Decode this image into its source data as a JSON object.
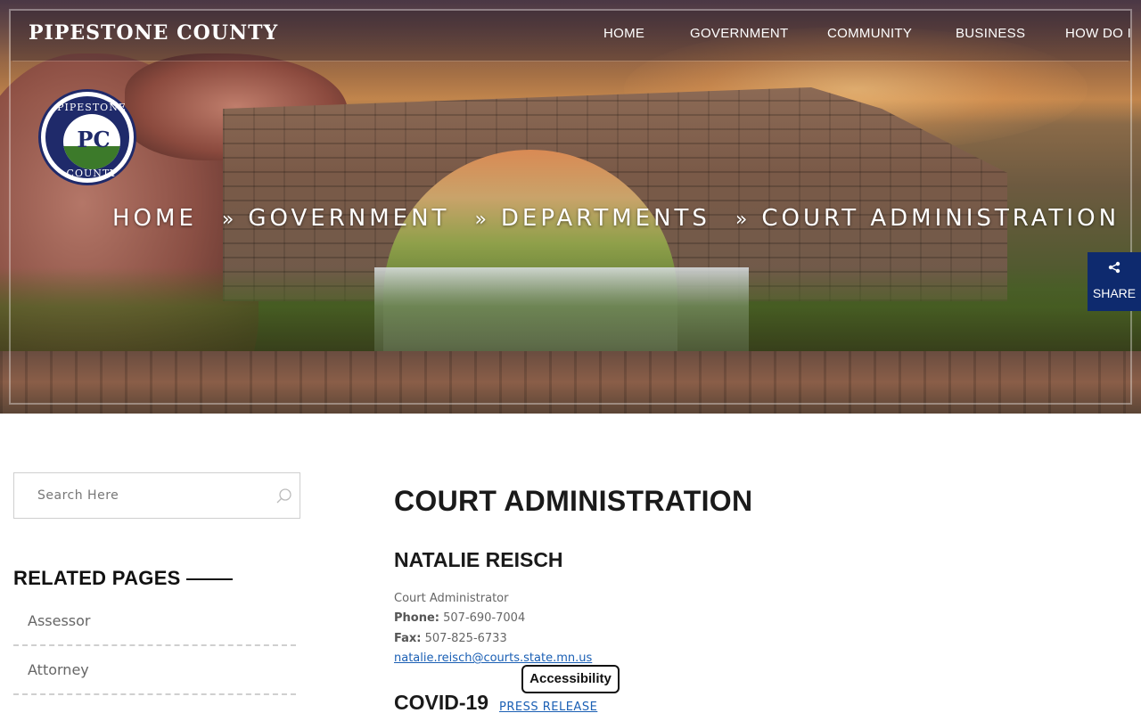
{
  "header": {
    "site_title": "PIPESTONE COUNTY",
    "nav": {
      "home": "HOME",
      "government": "GOVERNMENT",
      "community": "COMMUNITY",
      "business": "BUSINESS",
      "how_do_i": "HOW DO I"
    }
  },
  "logo": {
    "top_text": "PIPESTONE",
    "bottom_text": "COUNTY",
    "letters": "PC"
  },
  "breadcrumb": {
    "items": [
      "HOME",
      "GOVERNMENT",
      "DEPARTMENTS",
      "COURT ADMINISTRATION"
    ],
    "separator": "»"
  },
  "share": {
    "label": "SHARE",
    "icon": "share-icon"
  },
  "sidebar": {
    "search_placeholder": "Search Here",
    "related_title": "RELATED PAGES",
    "related_items": [
      "Assessor",
      "Attorney"
    ]
  },
  "main": {
    "page_title": "COURT ADMINISTRATION",
    "contact": {
      "name": "NATALIE REISCH",
      "role": "Court Administrator",
      "phone_label": "Phone:",
      "phone": "507-690-7004",
      "fax_label": "Fax:",
      "fax": "507-825-6733",
      "email": "natalie.reisch@courts.state.mn.us"
    },
    "covid_heading": "COVID-19",
    "press_release": "PRESS RELEASE"
  },
  "accessibility_button": "Accessibility",
  "colors": {
    "share_bg": "#0e2a6e",
    "link": "#1a5fb4",
    "logo_blue": "#1f2a6a"
  }
}
